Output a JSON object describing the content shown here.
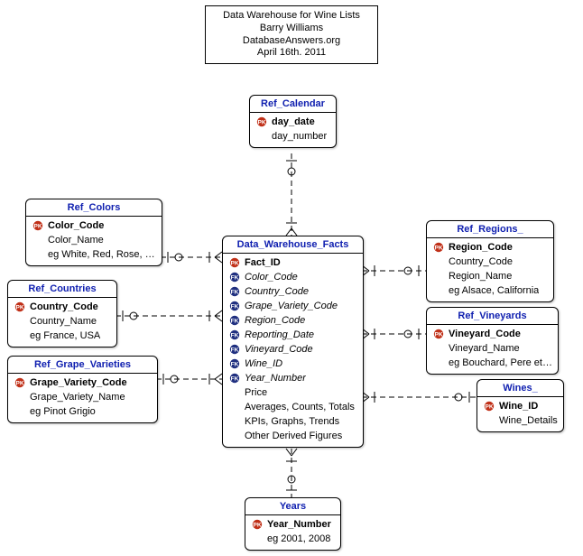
{
  "title": {
    "line1": "Data Warehouse for Wine Lists",
    "line2": "Barry Williams",
    "line3": "DatabaseAnswers.org",
    "line4": "April 16th. 2011"
  },
  "entities": {
    "calendar": {
      "name": "Ref_Calendar",
      "attrs": [
        {
          "key": "PK",
          "text": "day_date",
          "bold": true
        },
        {
          "key": "",
          "text": "day_number"
        }
      ]
    },
    "colors": {
      "name": "Ref_Colors",
      "attrs": [
        {
          "key": "PK",
          "text": "Color_Code",
          "bold": true
        },
        {
          "key": "",
          "text": "Color_Name"
        },
        {
          "key": "",
          "text": "eg White, Red, Rose, N/A"
        }
      ]
    },
    "countries": {
      "name": "Ref_Countries",
      "attrs": [
        {
          "key": "PK",
          "text": "Country_Code",
          "bold": true
        },
        {
          "key": "",
          "text": "Country_Name"
        },
        {
          "key": "",
          "text": "eg France, USA"
        }
      ]
    },
    "grape": {
      "name": "Ref_Grape_Varieties",
      "attrs": [
        {
          "key": "PK",
          "text": "Grape_Variety_Code",
          "bold": true
        },
        {
          "key": "",
          "text": "Grape_Variety_Name"
        },
        {
          "key": "",
          "text": "eg Pinot Grigio"
        }
      ]
    },
    "facts": {
      "name": "Data_Warehouse_Facts",
      "attrs": [
        {
          "key": "PK",
          "text": "Fact_ID",
          "bold": true
        },
        {
          "key": "FK",
          "text": "Color_Code",
          "italic": true
        },
        {
          "key": "FK",
          "text": "Country_Code",
          "italic": true
        },
        {
          "key": "FK",
          "text": "Grape_Variety_Code",
          "italic": true
        },
        {
          "key": "FK",
          "text": "Region_Code",
          "italic": true
        },
        {
          "key": "FK",
          "text": "Reporting_Date",
          "italic": true
        },
        {
          "key": "FK",
          "text": "Vineyard_Code",
          "italic": true
        },
        {
          "key": "FK",
          "text": "Wine_ID",
          "italic": true
        },
        {
          "key": "FK",
          "text": "Year_Number",
          "italic": true
        },
        {
          "key": "",
          "text": "Price"
        },
        {
          "key": "",
          "text": "Averages, Counts, Totals"
        },
        {
          "key": "",
          "text": "KPIs, Graphs, Trends"
        },
        {
          "key": "",
          "text": "Other Derived Figures"
        }
      ]
    },
    "regions": {
      "name": "Ref_Regions_",
      "attrs": [
        {
          "key": "PK",
          "text": "Region_Code",
          "bold": true
        },
        {
          "key": "",
          "text": "Country_Code"
        },
        {
          "key": "",
          "text": "Region_Name"
        },
        {
          "key": "",
          "text": "eg Alsace,  California"
        }
      ]
    },
    "vineyards": {
      "name": "Ref_Vineyards",
      "attrs": [
        {
          "key": "PK",
          "text": "Vineyard_Code",
          "bold": true
        },
        {
          "key": "",
          "text": "Vineyard_Name"
        },
        {
          "key": "",
          "text": "eg Bouchard, Pere et Fils"
        }
      ]
    },
    "wines": {
      "name": "Wines_",
      "attrs": [
        {
          "key": "PK",
          "text": "Wine_ID",
          "bold": true
        },
        {
          "key": "",
          "text": "Wine_Details"
        }
      ]
    },
    "years": {
      "name": "Years",
      "attrs": [
        {
          "key": "PK",
          "text": "Year_Number",
          "bold": true
        },
        {
          "key": "",
          "text": "eg 2001, 2008"
        }
      ]
    }
  },
  "relationships": [
    {
      "from": "facts",
      "to": "calendar"
    },
    {
      "from": "facts",
      "to": "colors"
    },
    {
      "from": "facts",
      "to": "countries"
    },
    {
      "from": "facts",
      "to": "grape"
    },
    {
      "from": "facts",
      "to": "regions"
    },
    {
      "from": "facts",
      "to": "vineyards"
    },
    {
      "from": "facts",
      "to": "wines"
    },
    {
      "from": "facts",
      "to": "years"
    }
  ]
}
